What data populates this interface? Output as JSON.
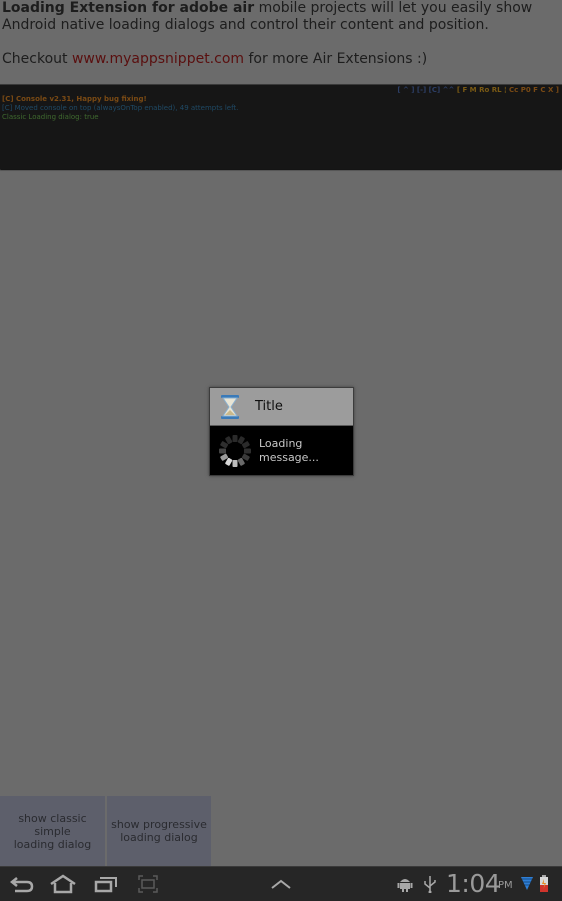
{
  "intro": {
    "bold": "Loading Extension for adobe air",
    "rest": " mobile projects will let you easily show Android native loading dialogs and control their content and position.",
    "checkout_prefix": "Checkout ",
    "link": "www.myappsnippet.com",
    "checkout_suffix": " for more Air Extensions :)"
  },
  "console": {
    "lines": [
      "[C] Console v2.31, Happy bug fixing!",
      "[C] Moved console on top (alwaysOnTop enabled), 49 attempts left.",
      "Classic Loading dialog:  true"
    ],
    "controls": {
      "window": "[ ^ ] [-] [C]",
      "arrows": "^^",
      "filters": "[ F M Ro RL",
      "sep": "¦",
      "tools": "Cc P0 F C X ]"
    }
  },
  "dialog": {
    "icon": "hourglass-icon",
    "title": "Title",
    "message_line1": "Loading",
    "message_line2": "message..."
  },
  "buttons": {
    "classic_line1": "show classic simple",
    "classic_line2": "loading dialog",
    "progressive_line1": "show progressive",
    "progressive_line2": "loading dialog"
  },
  "navbar": {
    "back": "back-icon",
    "home": "home-icon",
    "recent": "recent-apps-icon",
    "screenshot": "screenshot-icon",
    "up": "chevron-up-icon",
    "time": "1:04",
    "ampm": "PM"
  }
}
